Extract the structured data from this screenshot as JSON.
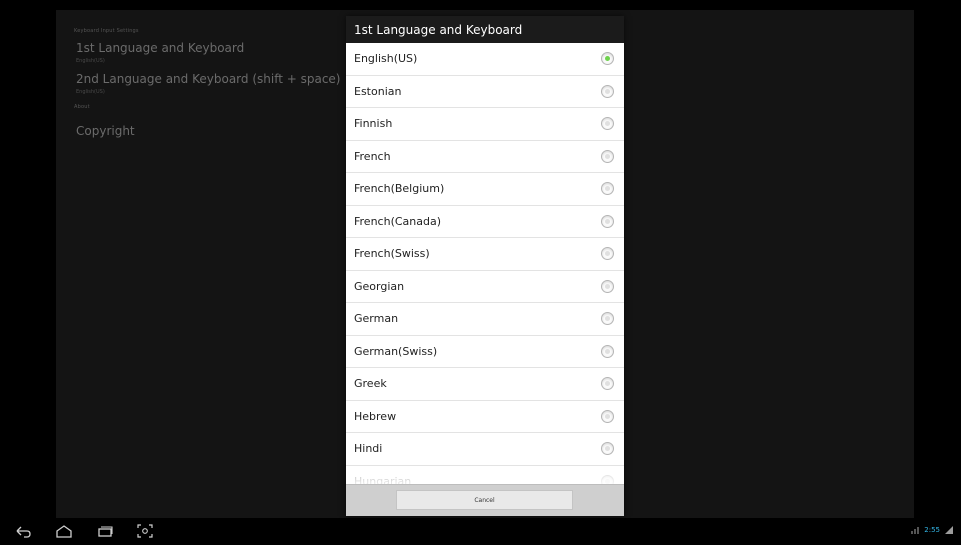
{
  "settings": {
    "section_input": "Keyboard Input Settings",
    "pref1_title": "1st Language and Keyboard",
    "pref1_summary": "English(US)",
    "pref2_title": "2nd Language and Keyboard (shift + space)",
    "pref2_summary": "English(US)",
    "section_about": "About",
    "copyright": "Copyright"
  },
  "dialog": {
    "title": "1st Language and Keyboard",
    "cancel_label": "Cancel",
    "selected": "English(US)",
    "languages": [
      "English(US)",
      "Estonian",
      "Finnish",
      "French",
      "French(Belgium)",
      "French(Canada)",
      "French(Swiss)",
      "Georgian",
      "German",
      "German(Swiss)",
      "Greek",
      "Hebrew",
      "Hindi",
      "Hungarian"
    ]
  },
  "status": {
    "time": "2:55"
  },
  "colors": {
    "accent": "#33b5e5",
    "radio_selected": "#6fd24e"
  },
  "icons": [
    "back-icon",
    "home-icon",
    "recent-apps-icon",
    "screenshot-icon",
    "signal-icon",
    "wifi-icon"
  ]
}
